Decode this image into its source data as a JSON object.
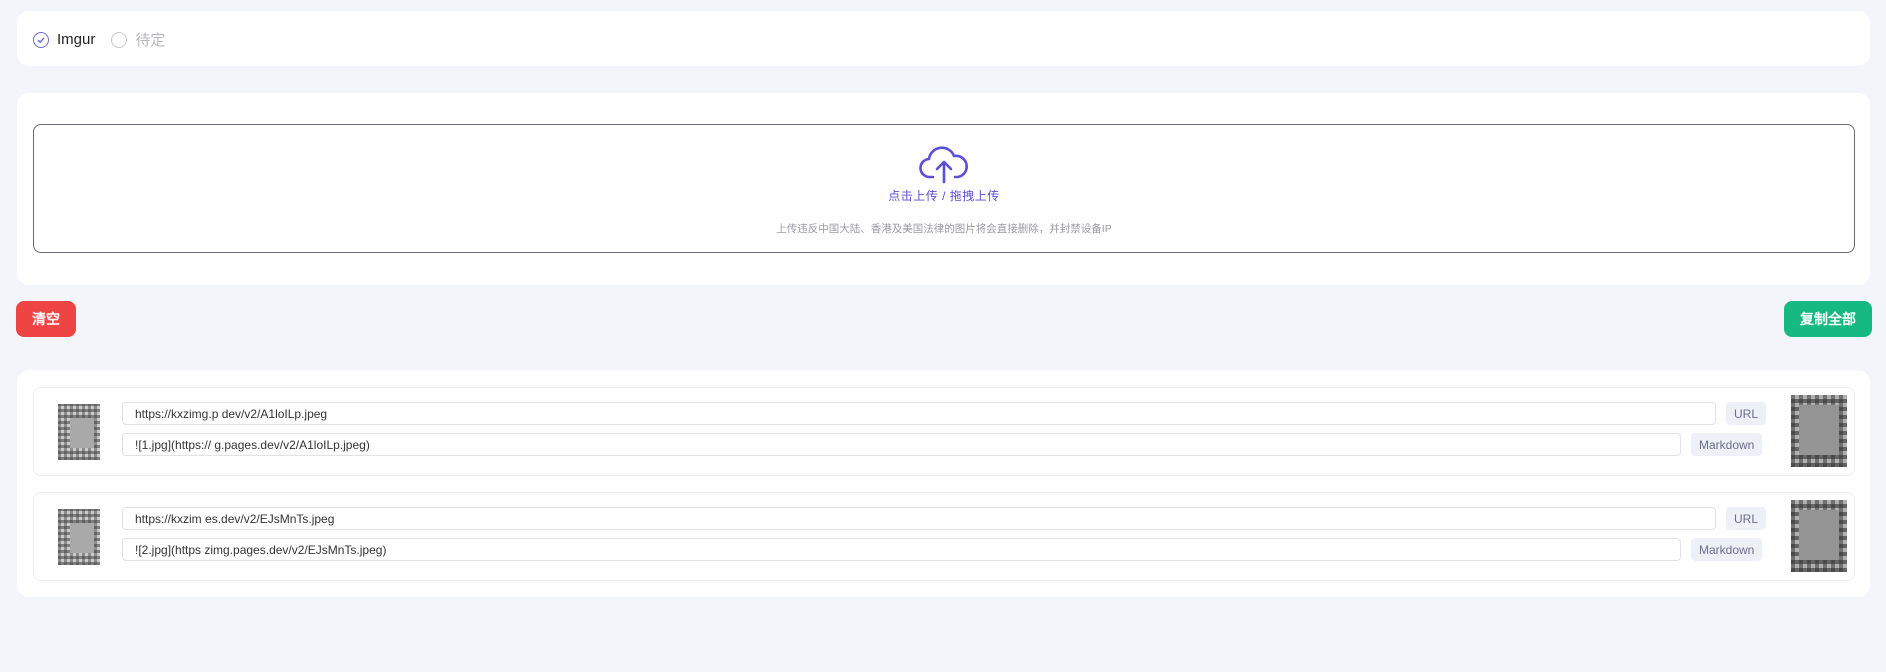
{
  "providers": {
    "options": [
      {
        "label": "Imgur",
        "selected": true
      },
      {
        "label": "待定",
        "selected": false
      }
    ]
  },
  "upload": {
    "title": "点击上传 / 拖拽上传",
    "hint": "上传违反中国大陆、香港及美国法律的图片将会直接删除，并封禁设备IP",
    "icon": "cloud-upload-icon"
  },
  "actions": {
    "clear_label": "清空",
    "copy_all_label": "复制全部"
  },
  "colors": {
    "accent": "#5b4fd6",
    "danger": "#ef4444",
    "success": "#16b981"
  },
  "results": [
    {
      "url": "https://kxzimg.p      dev/v2/A1loILp.jpeg",
      "url_tag": "URL",
      "markdown": "![1.jpg](https://      g.pages.dev/v2/A1loILp.jpeg)",
      "markdown_tag": "Markdown"
    },
    {
      "url": "https://kxzim      es.dev/v2/EJsMnTs.jpeg",
      "url_tag": "URL",
      "markdown": "![2.jpg](https      zimg.pages.dev/v2/EJsMnTs.jpeg)",
      "markdown_tag": "Markdown"
    }
  ]
}
